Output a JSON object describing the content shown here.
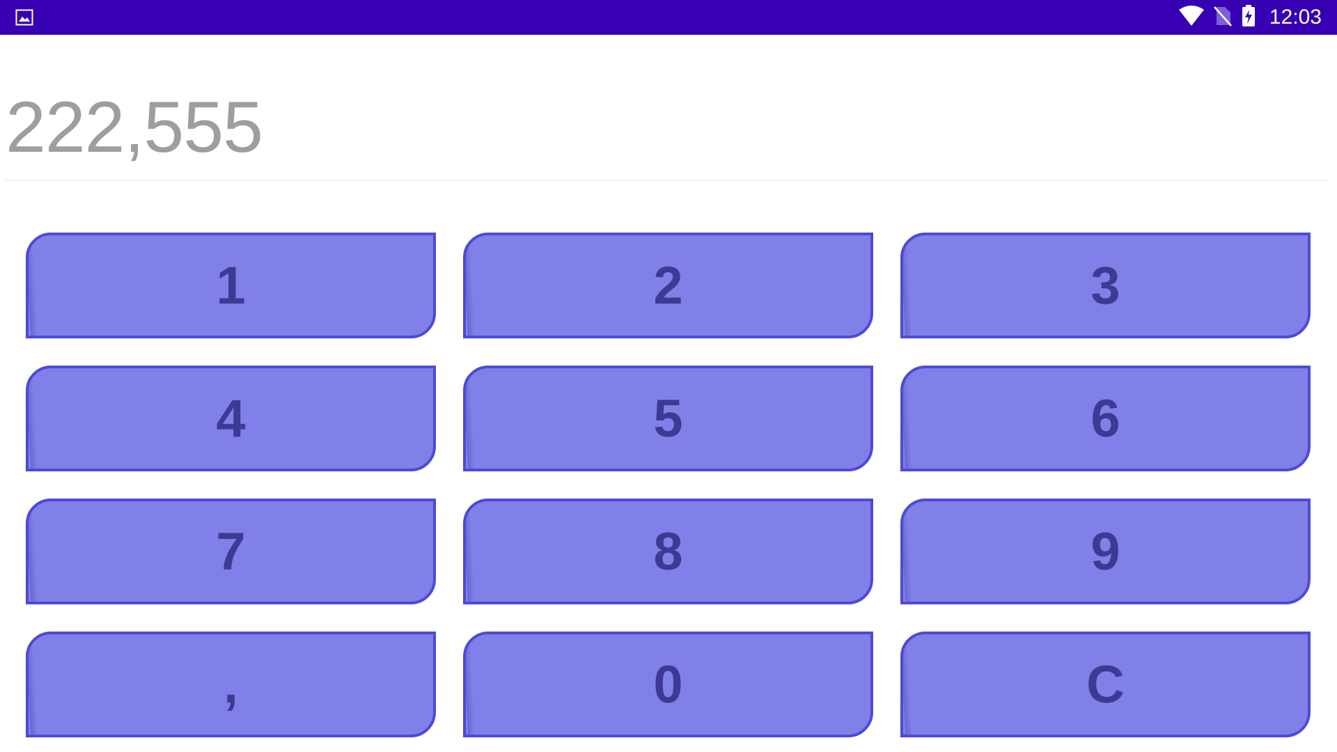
{
  "status_bar": {
    "time": "12:03",
    "background": "#3700b3",
    "icons": [
      "image-icon",
      "wifi-icon",
      "no-sim-icon",
      "battery-charging-icon"
    ]
  },
  "display": {
    "value": "222,555"
  },
  "keypad": {
    "keys": [
      "1",
      "2",
      "3",
      "4",
      "5",
      "6",
      "7",
      "8",
      "9",
      ",",
      "0",
      "C"
    ],
    "key_color": "#8080e8",
    "key_border_color": "#4d4ad6",
    "key_text_color": "#3e3a94"
  }
}
